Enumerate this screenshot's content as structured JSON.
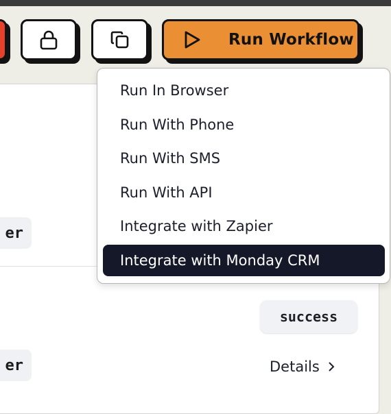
{
  "toolbar": {
    "run_workflow_label": "Run Workflow",
    "icons": [
      "lock-icon",
      "copy-icon",
      "play-icon"
    ],
    "accent_color": "#eb8f35",
    "danger_color": "#e5412b"
  },
  "run_menu": {
    "items": [
      {
        "label": "Run In Browser"
      },
      {
        "label": "Run With Phone"
      },
      {
        "label": "Run With SMS"
      },
      {
        "label": "Run With API"
      },
      {
        "label": "Integrate with Zapier"
      },
      {
        "label": "Integrate with Monday CRM",
        "highlighted": true
      }
    ]
  },
  "runs": {
    "rows": [
      {
        "trigger_chip": "er"
      },
      {
        "status": "success",
        "trigger_chip": "er",
        "details_label": "Details"
      }
    ]
  }
}
